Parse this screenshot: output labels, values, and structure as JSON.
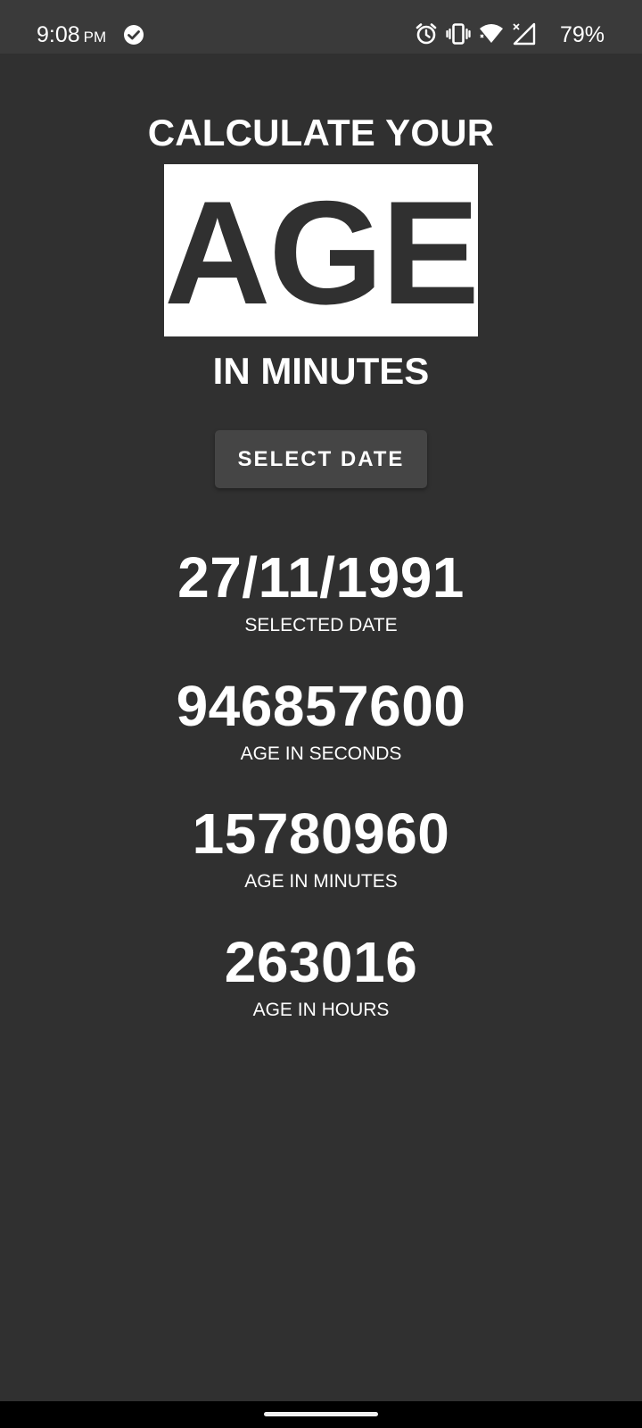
{
  "status_bar": {
    "time": "9:08",
    "ampm": "PM",
    "battery": "79%",
    "icons": [
      "check-circle-icon",
      "alarm-icon",
      "vibrate-icon",
      "wifi-icon",
      "cell-signal-icon",
      "battery-icon"
    ]
  },
  "header": {
    "line1": "CALCULATE YOUR",
    "big_word": "AGE",
    "line2": "IN MINUTES"
  },
  "select_button": {
    "label": "SELECT DATE"
  },
  "results": {
    "selected_date": {
      "value": "27/11/1991",
      "label": "SELECTED DATE"
    },
    "seconds": {
      "value": "946857600",
      "label": "AGE IN SECONDS"
    },
    "minutes": {
      "value": "15780960",
      "label": "AGE IN MINUTES"
    },
    "hours": {
      "value": "263016",
      "label": "AGE IN HOURS"
    }
  },
  "colors": {
    "background": "#303030",
    "status_bar": "#3a3a3a",
    "button": "#454545",
    "text": "#ffffff"
  }
}
